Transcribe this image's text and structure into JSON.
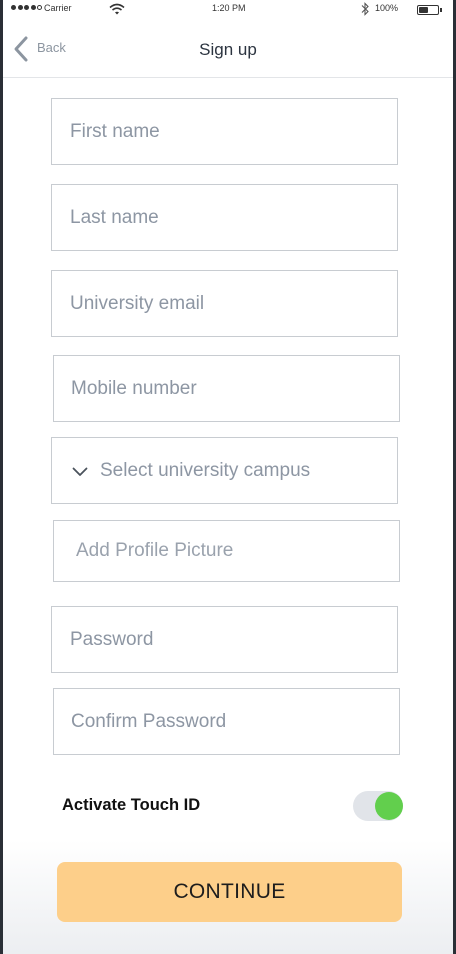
{
  "status_bar": {
    "carrier": "Carrier",
    "time": "1:20 PM",
    "battery_percent": "100%",
    "battery_level": 0.5
  },
  "nav": {
    "back_label": "Back",
    "title": "Sign up"
  },
  "form": {
    "first_name_placeholder": "First name",
    "last_name_placeholder": "Last name",
    "email_placeholder": "University email",
    "mobile_placeholder": "Mobile number",
    "campus_placeholder": "Select university campus",
    "profile_picture_label": "Add Profile Picture",
    "password_placeholder": "Password",
    "confirm_password_placeholder": "Confirm Password"
  },
  "touch_id": {
    "label": "Activate Touch ID",
    "enabled": true,
    "toggle_on_color": "#62cf4d"
  },
  "continue_button": {
    "label": "CONTINUE",
    "color": "#fdcf8a"
  }
}
